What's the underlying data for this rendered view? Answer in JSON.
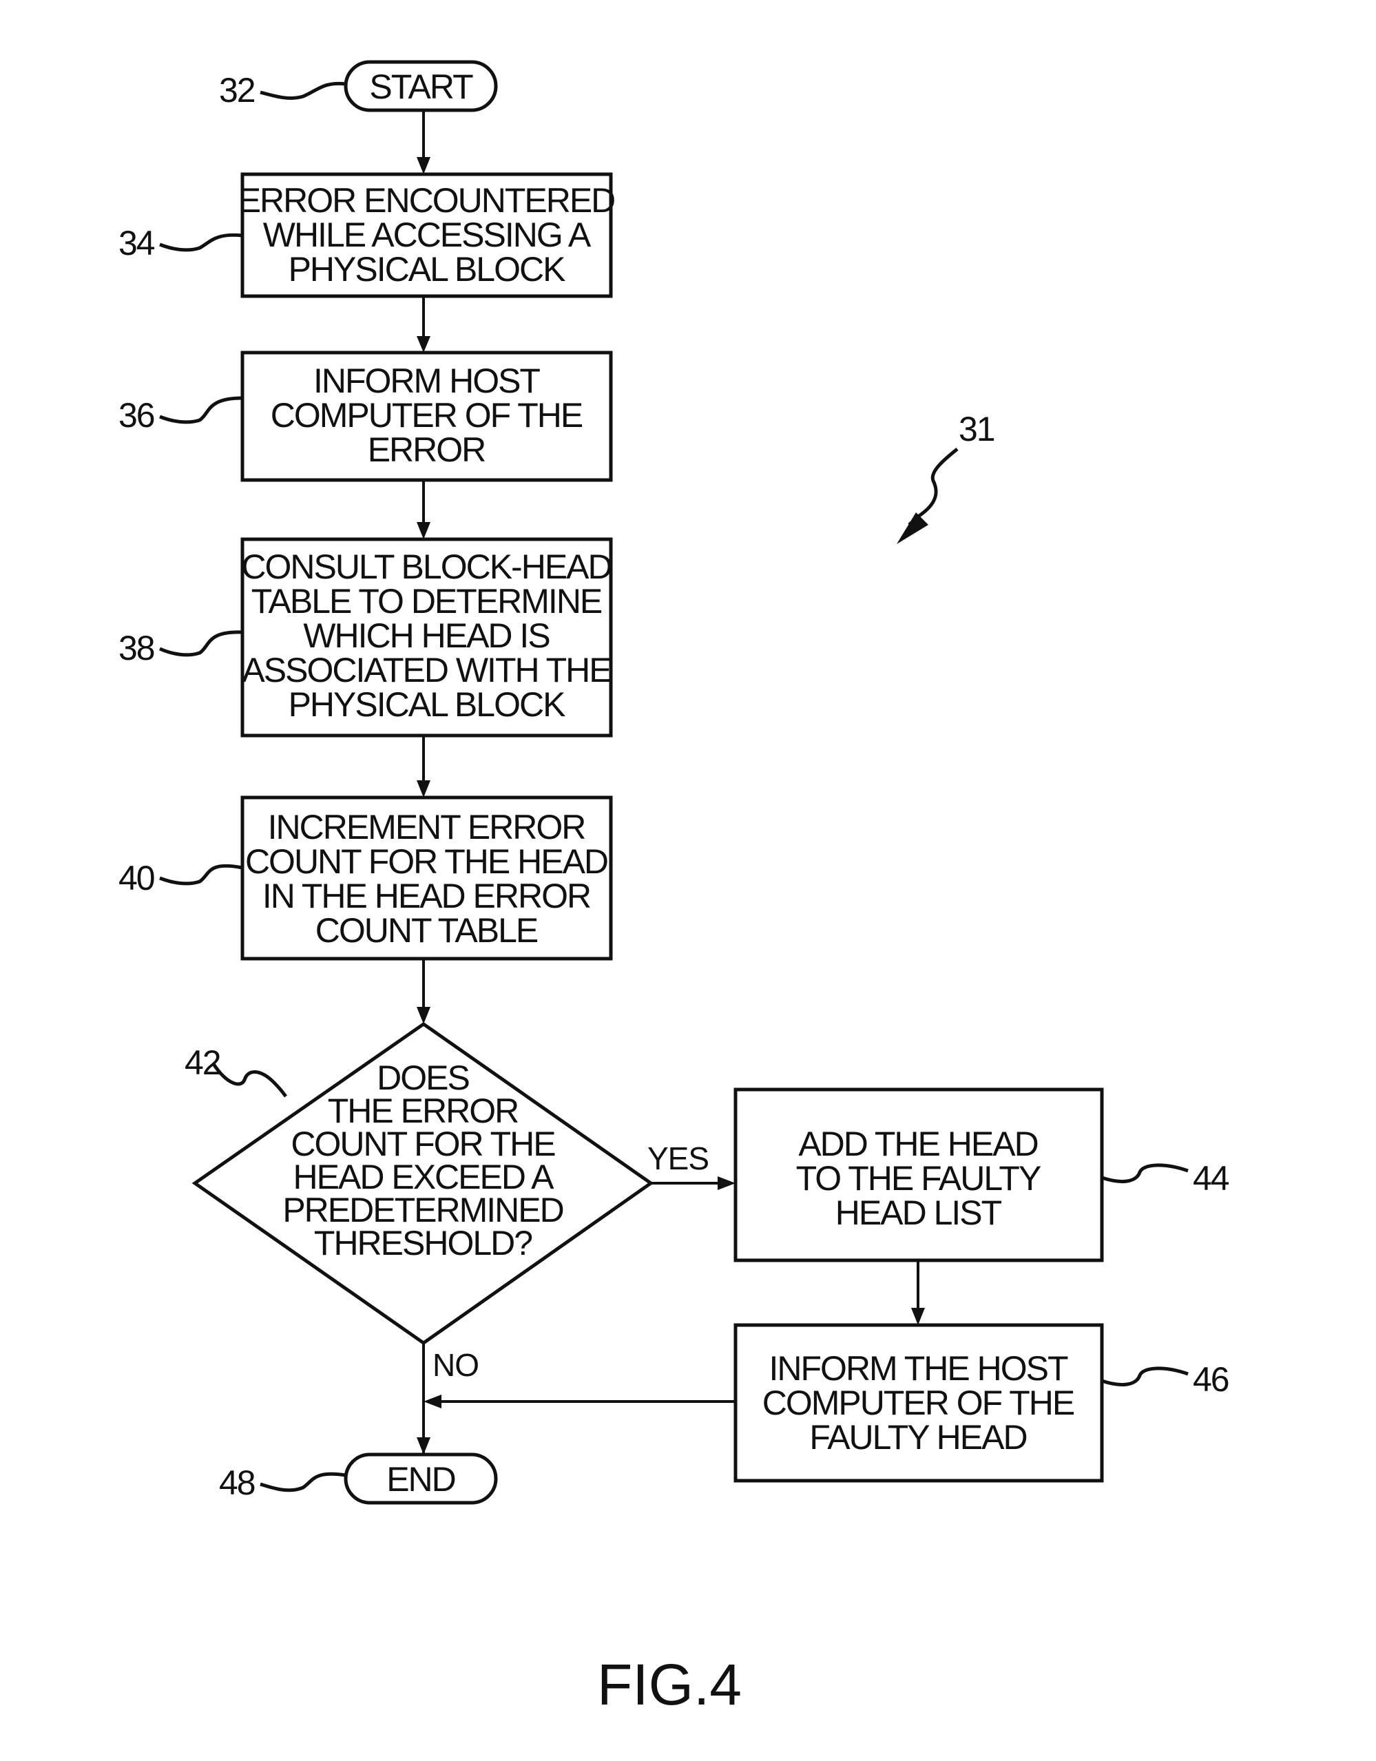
{
  "figure": {
    "caption": "FIG.4",
    "reference": "31"
  },
  "nodes": {
    "start": {
      "ref": "32",
      "type": "terminator",
      "lines": [
        "START"
      ]
    },
    "step34": {
      "ref": "34",
      "type": "process",
      "lines": [
        "ERROR ENCOUNTERED",
        "WHILE ACCESSING A",
        "PHYSICAL BLOCK"
      ]
    },
    "step36": {
      "ref": "36",
      "type": "process",
      "lines": [
        "INFORM HOST",
        "COMPUTER OF THE",
        "ERROR"
      ]
    },
    "step38": {
      "ref": "38",
      "type": "process",
      "lines": [
        "CONSULT BLOCK-HEAD",
        "TABLE TO DETERMINE",
        "WHICH HEAD IS",
        "ASSOCIATED WITH THE",
        "PHYSICAL BLOCK"
      ]
    },
    "step40": {
      "ref": "40",
      "type": "process",
      "lines": [
        "INCREMENT ERROR",
        "COUNT FOR THE HEAD",
        "IN THE HEAD ERROR",
        "COUNT TABLE"
      ]
    },
    "decision42": {
      "ref": "42",
      "type": "decision",
      "lines": [
        "DOES",
        "THE ERROR",
        "COUNT FOR THE",
        "HEAD EXCEED A",
        "PREDETERMINED",
        "THRESHOLD?"
      ]
    },
    "step44": {
      "ref": "44",
      "type": "process",
      "lines": [
        "ADD THE HEAD",
        "TO THE FAULTY",
        "HEAD LIST"
      ]
    },
    "step46": {
      "ref": "46",
      "type": "process",
      "lines": [
        "INFORM THE HOST",
        "COMPUTER OF THE",
        "FAULTY HEAD"
      ]
    },
    "end": {
      "ref": "48",
      "type": "terminator",
      "lines": [
        "END"
      ]
    }
  },
  "edges": [
    {
      "from": "start",
      "to": "step34",
      "label": ""
    },
    {
      "from": "step34",
      "to": "step36",
      "label": ""
    },
    {
      "from": "step36",
      "to": "step38",
      "label": ""
    },
    {
      "from": "step38",
      "to": "step40",
      "label": ""
    },
    {
      "from": "step40",
      "to": "decision42",
      "label": ""
    },
    {
      "from": "decision42",
      "to": "step44",
      "label": "YES"
    },
    {
      "from": "decision42",
      "to": "end",
      "label": "NO"
    },
    {
      "from": "step44",
      "to": "step46",
      "label": ""
    },
    {
      "from": "step46",
      "to": "end",
      "label": ""
    }
  ],
  "branch_labels": {
    "yes": "YES",
    "no": "NO"
  }
}
